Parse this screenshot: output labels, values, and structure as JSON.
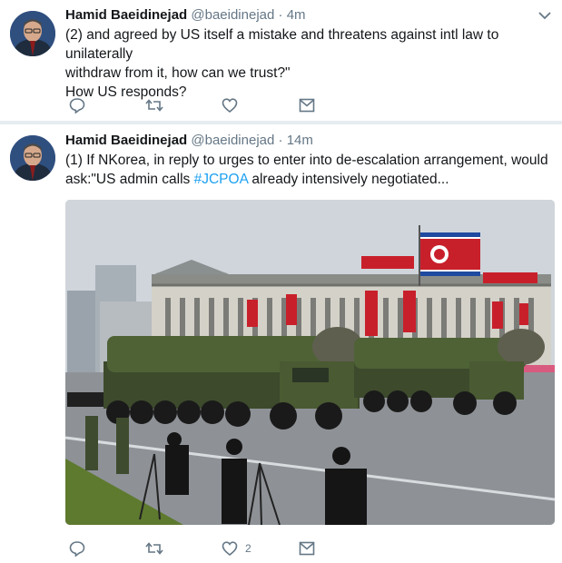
{
  "tweets": [
    {
      "author_name": "Hamid Baeidinejad",
      "handle": "@baeidinejad",
      "separator": "·",
      "time": "4m",
      "text_line1": "(2) and agreed by US itself a mistake and threatens against intl law to unilaterally",
      "text_line2": "withdraw from it, how can we trust?\"",
      "text_line3": "How US responds?",
      "like_count": ""
    },
    {
      "author_name": "Hamid Baeidinejad",
      "handle": "@baeidinejad",
      "separator": "·",
      "time": "14m",
      "text_line1": "(1) If NKorea, in reply to urges to enter into de-escalation arrangement, would",
      "text_line2_pre": "ask:\"US admin calls ",
      "hashtag": "#JCPOA",
      "text_line2_post": " already intensively negotiated...",
      "like_count": "2"
    }
  ],
  "icons": [
    "reply-icon",
    "retweet-icon",
    "like-icon",
    "message-icon",
    "chevron-down-icon"
  ],
  "colors": {
    "text": "#14171a",
    "muted": "#657786",
    "hashtag": "#1da1f2",
    "background": "#e6ecf0"
  }
}
